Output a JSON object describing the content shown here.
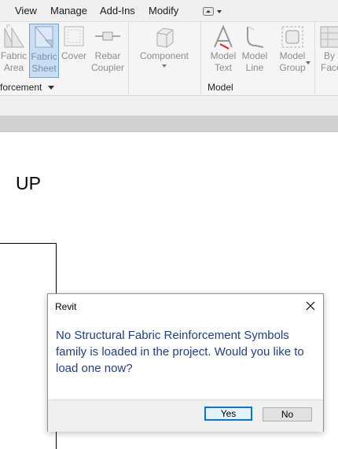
{
  "menu": {
    "items": [
      "View",
      "Manage",
      "Add-Ins",
      "Modify"
    ]
  },
  "ribbon": {
    "tools": {
      "fabric_area": [
        "Fabric",
        "Area"
      ],
      "fabric_sheet": [
        "Fabric",
        "Sheet"
      ],
      "cover": [
        "Cover",
        ""
      ],
      "rebar_coupler": [
        "Rebar",
        "Coupler"
      ],
      "component": [
        "Component",
        ""
      ],
      "model_text": [
        "Model",
        "Text"
      ],
      "model_line": [
        "Model",
        "Line"
      ],
      "model_group": [
        "Model",
        "Group"
      ],
      "by_face": [
        "By",
        "Face"
      ]
    },
    "panels": {
      "reinforcement": "forcement",
      "model": "Model"
    }
  },
  "canvas": {
    "label": "UP"
  },
  "dialog": {
    "title": "Revit",
    "message": "No Structural Fabric Reinforcement Symbols family is loaded in the project. Would you like to load one now?",
    "yes_label": "Yes",
    "no_label": "No"
  },
  "colors": {
    "accent": "#0078d7",
    "message_text": "#1f3f8c",
    "selected_tool": "#c9def5"
  }
}
